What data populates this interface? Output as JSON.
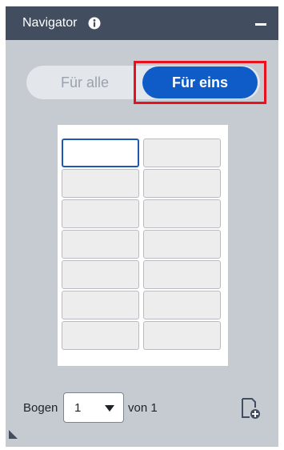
{
  "header": {
    "title": "Navigator",
    "info_icon": "info-circle-icon",
    "collapse_icon": "minus-icon"
  },
  "toggle": {
    "option_all": "Für alle",
    "option_one": "Für eins",
    "selected": "Für eins"
  },
  "sheet": {
    "columns": 2,
    "rows": 7,
    "selected_cell": {
      "row": 1,
      "column": 1
    }
  },
  "footer": {
    "sheet_label": "Bogen",
    "sheet_value": "1",
    "of_label": "von 1",
    "add_icon": "add-page-icon"
  },
  "colors": {
    "header_bg": "#424e5f",
    "panel_bg": "#c6cbd2",
    "accent": "#0f5bc8",
    "highlight": "#e8121e"
  }
}
